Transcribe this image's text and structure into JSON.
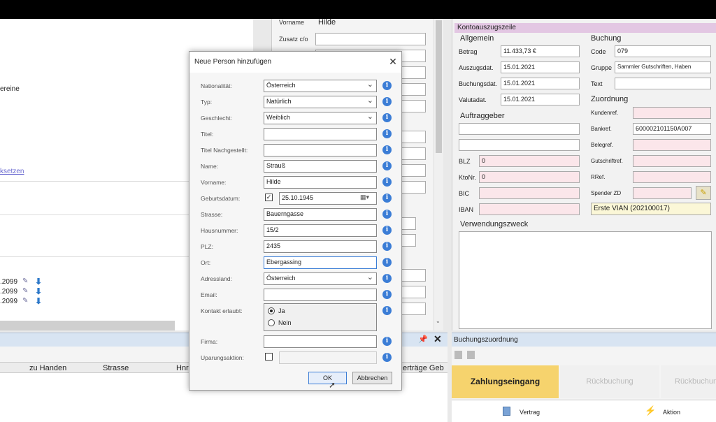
{
  "left": {
    "fragment_vereine": "ereine",
    "fragment_link": "ksetzen",
    "rows": [
      ".2099",
      ".2099",
      ".2099"
    ]
  },
  "mid": {
    "vorname_label": "Vorname",
    "vorname_value": "Hilde",
    "zusatz_label": "Zusatz c/o"
  },
  "bottom_left": {
    "columns": [
      "zu Handen",
      "Strasse",
      "Hnr",
      "erträge Geb"
    ]
  },
  "right": {
    "header": "Kontoauszugszeile",
    "allgemein": {
      "title": "Allgemein",
      "betrag_label": "Betrag",
      "betrag_value": "11.433,73 €",
      "auszugsdat_label": "Auszugsdat.",
      "auszugsdat_value": "15.01.2021",
      "buchungsdat_label": "Buchungsdat.",
      "buchungsdat_value": "15.01.2021",
      "valutadat_label": "Valutadat.",
      "valutadat_value": "15.01.2021"
    },
    "buchung": {
      "title": "Buchung",
      "code_label": "Code",
      "code_value": "079",
      "gruppe_label": "Gruppe",
      "gruppe_value": "Sammler Gutschriften, Haben",
      "text_label": "Text"
    },
    "auftraggeber": {
      "title": "Auftraggeber",
      "blz_label": "BLZ",
      "blz_value": "0",
      "ktonr_label": "KtoNr.",
      "ktonr_value": "0",
      "bic_label": "BIC",
      "iban_label": "IBAN"
    },
    "zuordnung": {
      "title": "Zuordnung",
      "kundenref_label": "Kundenref.",
      "bankref_label": "Bankref.",
      "bankref_value": "600002101150A007",
      "belegref_label": "Belegref.",
      "gutschriftref_label": "Gutschriftref.",
      "rref_label": "RRef.",
      "spender_label": "Spender ZD",
      "spender_display": "Erste VIAN (202100017)"
    },
    "verwendung_title": "Verwendungszweck"
  },
  "buchungszuordnung": {
    "title": "Buchungszuordnung",
    "tabs": [
      "Zahlungseingang",
      "Rückbuchung",
      "Rückbuchung"
    ],
    "vertrag": "Vertrag",
    "aktion": "Aktion"
  },
  "dialog": {
    "title": "Neue Person hinzufügen",
    "fields": {
      "nationalitaet": {
        "label": "Nationalität:",
        "value": "Österreich"
      },
      "typ": {
        "label": "Typ:",
        "value": "Natürlich"
      },
      "geschlecht": {
        "label": "Geschlecht:",
        "value": "Weiblich"
      },
      "titel": {
        "label": "Titel:",
        "value": ""
      },
      "titel_nach": {
        "label": "Titel Nachgestellt:",
        "value": ""
      },
      "name": {
        "label": "Name:",
        "value": "Strauß"
      },
      "vorname": {
        "label": "Vorname:",
        "value": "Hilde"
      },
      "geburtsdatum": {
        "label": "Geburtsdatum:",
        "value": "25.10.1945"
      },
      "strasse": {
        "label": "Strasse:",
        "value": "Bauerngasse"
      },
      "hausnummer": {
        "label": "Hausnummer:",
        "value": "15/2"
      },
      "plz": {
        "label": "PLZ:",
        "value": "2435"
      },
      "ort": {
        "label": "Ort:",
        "value": "Ebergassing"
      },
      "adressland": {
        "label": "Adressland:",
        "value": "Österreich"
      },
      "email": {
        "label": "Email:",
        "value": ""
      },
      "kontakt": {
        "label": "Kontakt erlaubt:",
        "ja": "Ja",
        "nein": "Nein",
        "selected": "Ja"
      },
      "firma": {
        "label": "Firma:",
        "value": ""
      },
      "uparungsaktion": {
        "label": "Uparungsaktion:",
        "value": ""
      }
    },
    "ok": "OK",
    "cancel": "Abbrechen"
  }
}
